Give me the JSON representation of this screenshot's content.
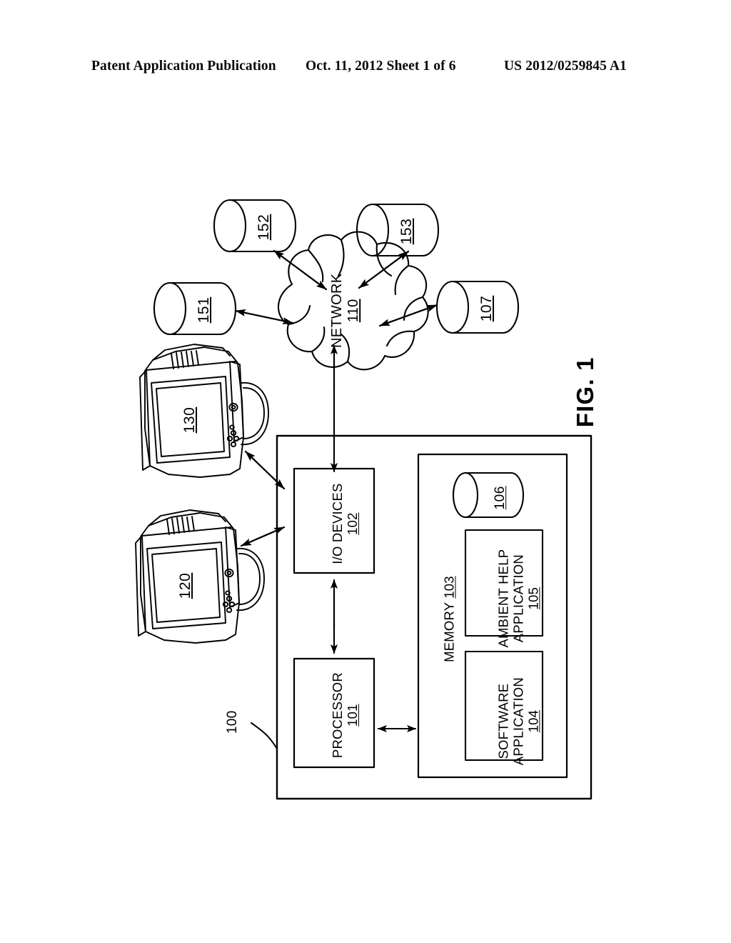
{
  "header": {
    "left": "Patent Application Publication",
    "middle": "Oct. 11, 2012   Sheet 1 of 6",
    "right": "US 2012/0259845 A1"
  },
  "figure": {
    "caption": "FIG. 1",
    "system_ref": "100"
  },
  "network": {
    "name": "NETWORK",
    "ref": "110"
  },
  "databases": [
    {
      "ref": "152",
      "name": "database-152"
    },
    {
      "ref": "153",
      "name": "database-153"
    },
    {
      "ref": "151",
      "name": "database-151"
    },
    {
      "ref": "107",
      "name": "database-107"
    }
  ],
  "monitors": [
    {
      "ref": "130",
      "name": "monitor-130"
    },
    {
      "ref": "120",
      "name": "monitor-120"
    }
  ],
  "system": {
    "io_devices": {
      "label": "I/O DEVICES",
      "ref": "102"
    },
    "processor": {
      "label": "PROCESSOR",
      "ref": "101"
    },
    "memory": {
      "label": "MEMORY",
      "ref": "103",
      "storage": {
        "ref": "106"
      },
      "modules": [
        {
          "line1": "SOFTWARE",
          "line2": "APPLICATION",
          "ref": "104"
        },
        {
          "line1": "AMBIENT HELP",
          "line2": "APPLICATION",
          "ref": "105"
        }
      ]
    }
  },
  "colors": {
    "ink": "#000000",
    "paper": "#ffffff"
  }
}
